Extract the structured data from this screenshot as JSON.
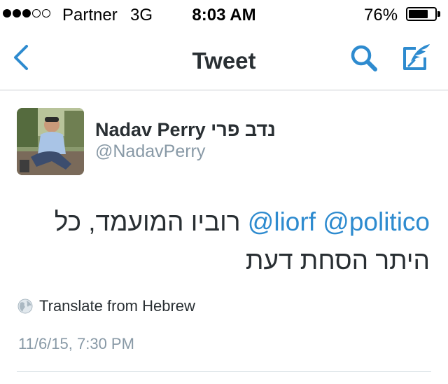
{
  "status_bar": {
    "signal_bars": 3,
    "signal_total": 5,
    "carrier": "Partner",
    "network": "3G",
    "time": "8:03 AM",
    "battery_percent": "76%",
    "battery_level": 0.76
  },
  "nav": {
    "title": "Tweet",
    "back_icon": "chevron-left-icon",
    "search_icon": "search-icon",
    "compose_icon": "compose-tweet-icon"
  },
  "tweet": {
    "display_name": "Nadav Perry נדב פרי",
    "handle": "@NadavPerry",
    "mentions": [
      "@politico",
      "@liorf"
    ],
    "text_rest": "רוביו המועמד, כל היתר הסחת דעת",
    "translate_label": "Translate from Hebrew",
    "timestamp": "11/6/15, 7:30 PM"
  },
  "colors": {
    "accent": "#2e8bcf",
    "text": "#292f33",
    "secondary": "#8899a6",
    "divider": "#d5dde2"
  }
}
